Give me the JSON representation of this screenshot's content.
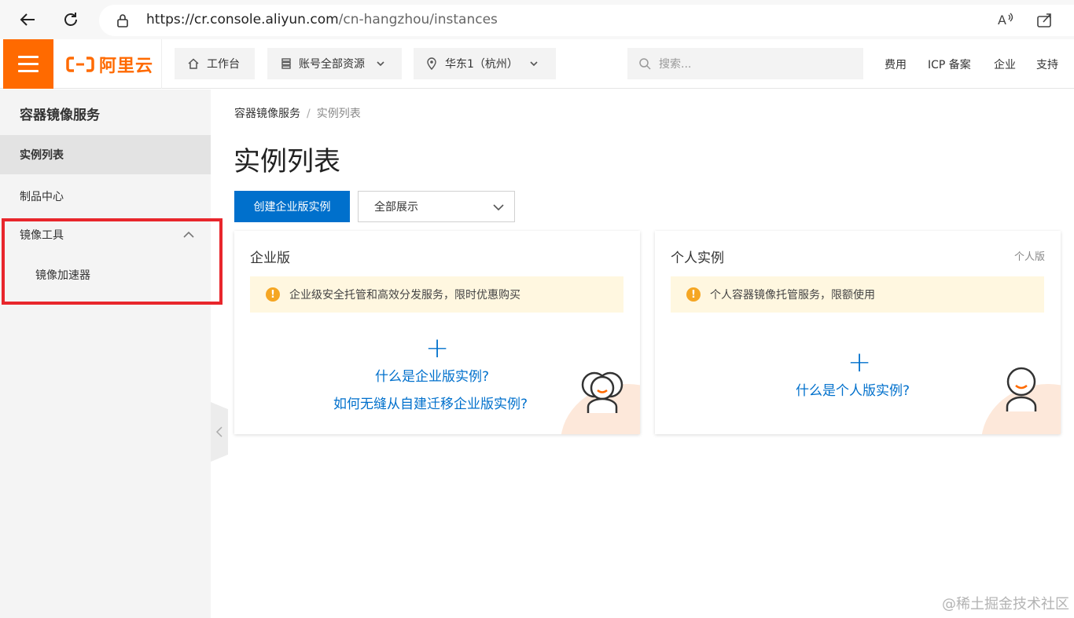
{
  "browser": {
    "url_host": "https://cr.console.aliyun.com",
    "url_path": "/cn-hangzhou/instances"
  },
  "header": {
    "logo_text": "阿里云",
    "workbench": "工作台",
    "resources": "账号全部资源",
    "region": "华东1（杭州）",
    "search_placeholder": "搜索...",
    "links": [
      "费用",
      "ICP 备案",
      "企业",
      "支持"
    ]
  },
  "sidebar": {
    "title": "容器镜像服务",
    "items": [
      {
        "label": "实例列表"
      },
      {
        "label": "制品中心"
      },
      {
        "label": "镜像工具"
      },
      {
        "label": "镜像加速器"
      }
    ]
  },
  "main": {
    "breadcrumb": [
      "容器镜像服务",
      "实例列表"
    ],
    "breadcrumb_sep": "/",
    "title": "实例列表",
    "create_button": "创建企业版实例",
    "filter_value": "全部展示"
  },
  "cards": {
    "enterprise": {
      "title": "企业版",
      "notice": "企业级安全托管和高效分发服务，限时优惠购买",
      "links": [
        "什么是企业版实例?",
        "如何无缝从自建迁移企业版实例?"
      ]
    },
    "personal": {
      "title": "个人实例",
      "tag": "个人版",
      "notice": "个人容器镜像托管服务，限额使用",
      "links": [
        "什么是个人版实例?"
      ]
    }
  },
  "watermark": "@稀土掘金技术社区",
  "colors": {
    "brand": "#ff6a00",
    "primary": "#0070cc",
    "highlight": "#e8262c",
    "notice_bg": "#fff7e0",
    "warn": "#f5a623"
  }
}
